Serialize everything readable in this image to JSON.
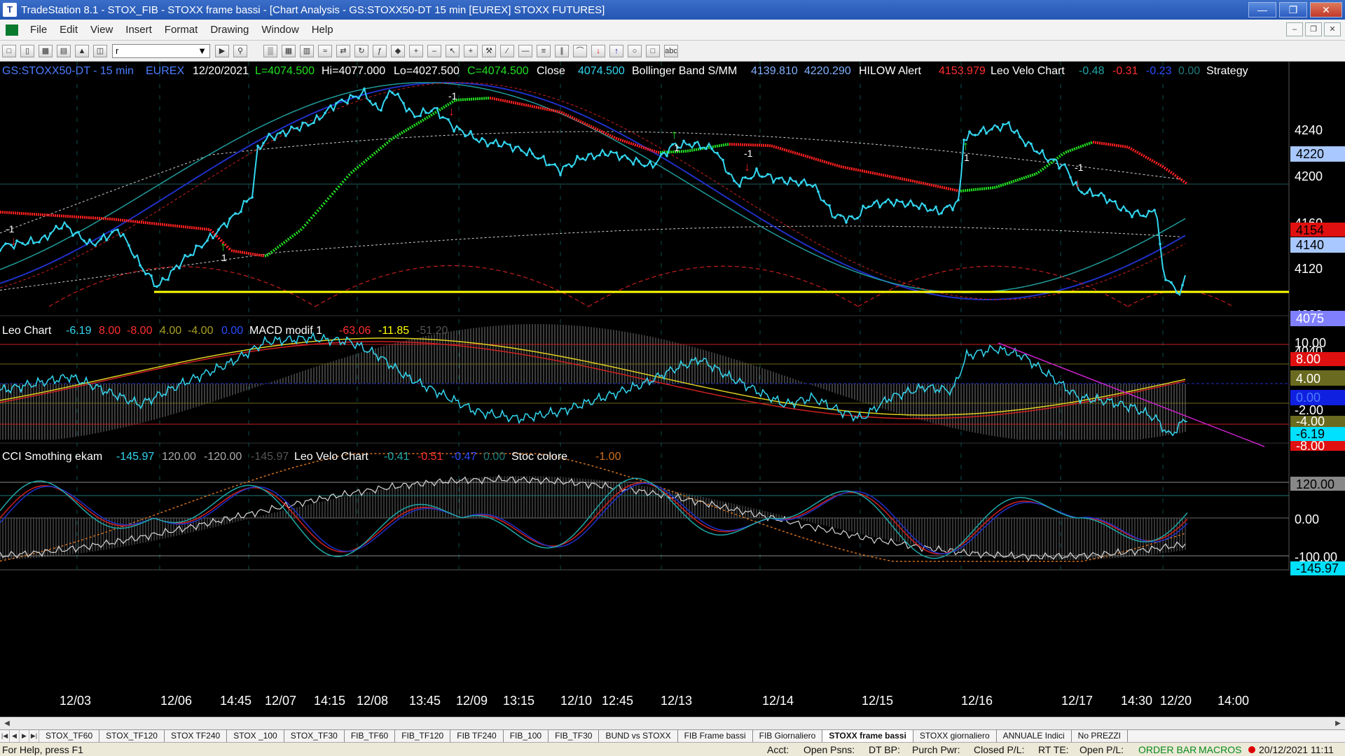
{
  "window": {
    "title": "TradeStation 8.1 - STOX_FIB - STOXX frame bassi - [Chart Analysis - GS:STOXX50-DT  15 min  [EUREX] STOXX FUTURES]"
  },
  "menu": [
    "File",
    "Edit",
    "View",
    "Insert",
    "Format",
    "Drawing",
    "Window",
    "Help"
  ],
  "toolbar": {
    "symbol_box": "r"
  },
  "header_main": {
    "symbol": "GS:STOXX50-DT - 15 min",
    "exchange": "EUREX",
    "date": "12/20/2021",
    "last": "L=4074.500",
    "high": "Hi=4077.000",
    "low": "Lo=4027.500",
    "close": "C=4074.500",
    "close_label": "Close",
    "close_value": "4074.500",
    "bb_label": "Bollinger Band S/MM",
    "bb_v1": "4139.810",
    "bb_v2": "4220.290",
    "hilow_label": "HILOW Alert",
    "hilow_value": "4153.979",
    "leo_label": "Leo Velo Chart",
    "leo_v1": "-0.48",
    "leo_v2": "-0.31",
    "leo_v3": "-0.23",
    "leo_v4": "0.00",
    "strategy": "Strategy"
  },
  "header_mid": {
    "leo_chart": "Leo Chart",
    "v1": "-6.19",
    "v2": "8.00",
    "v3": "-8.00",
    "v4": "4.00",
    "v5": "-4.00",
    "v6": "0.00",
    "macd_label": "MACD modif 1",
    "m1": "-63.06",
    "m2": "-11.85",
    "m3": "-51.20"
  },
  "header_low": {
    "cci_label": "CCI Smothing ekam",
    "c1": "-145.97",
    "c2": "120.00",
    "c3": "-120.00",
    "c4": "-145.97",
    "leo_label": "Leo Velo Chart",
    "l1": "-0.41",
    "l2": "-0.51",
    "l3": "-0.47",
    "l4": "0.00",
    "stoc_label": "Stoc colore",
    "s1": "-1.00"
  },
  "price_axis": {
    "ticks": [
      "4240",
      "4200",
      "4160",
      "4120",
      "4080",
      "4040"
    ],
    "marker_4220": "4220",
    "marker_4154": "4154",
    "marker_4140": "4140",
    "marker_4075": "4075"
  },
  "mid_axis": {
    "ticks": [
      "10.00",
      "-2.00"
    ],
    "marker_8": "8.00",
    "marker_4": "4.00",
    "marker_0": "0.00",
    "marker_m4": "-4.00",
    "marker_m619": "-6.19",
    "marker_m8": "-8.00"
  },
  "low_axis": {
    "marker_120": "120.00",
    "tick_0": "0.00",
    "tick_m100": "-100.00",
    "marker_m14597": "-145.97"
  },
  "time_axis": [
    "12/03",
    "12/06",
    "14:45",
    "12/07",
    "14:15",
    "12/08",
    "13:45",
    "12/09",
    "13:15",
    "12/10",
    "12:45",
    "12/13",
    "12/14",
    "12/15",
    "12/16",
    "12/17",
    "14:30",
    "12/20",
    "14:00"
  ],
  "signals": {
    "sell": "-1",
    "buy": "1"
  },
  "tabs": [
    "STOX_TF60",
    "STOX_TF120",
    "STOX TF240",
    "STOX _100",
    "STOX_TF30",
    "FIB_TF60",
    "FIB_TF120",
    "FIB TF240",
    "FIB_100",
    "FIB_TF30",
    "BUND vs STOXX",
    "FIB Frame bassi",
    "FIB Giornaliero",
    "STOXX frame bassi",
    "STOXX giornaliero",
    "ANNUALE Indici",
    "No PREZZI"
  ],
  "active_tab": "STOXX frame bassi",
  "status": {
    "help": "For Help, press F1",
    "acct": "Acct:",
    "open_psns": "Open Psns:",
    "dt_bp": "DT BP:",
    "purch_pwr": "Purch Pwr:",
    "closed_pl": "Closed P/L:",
    "rt_te": "RT TE:",
    "open_pl": "Open P/L:",
    "order_bar": "ORDER BAR",
    "macros": "MACROS",
    "datetime": "20/12/2021 11:11"
  },
  "colors": {
    "background": "#000000",
    "price": "#33d6f0",
    "bb_red": "#ff2020",
    "bb_green": "#22e022",
    "support": "#ffff00",
    "trend": "#cc22cc"
  }
}
